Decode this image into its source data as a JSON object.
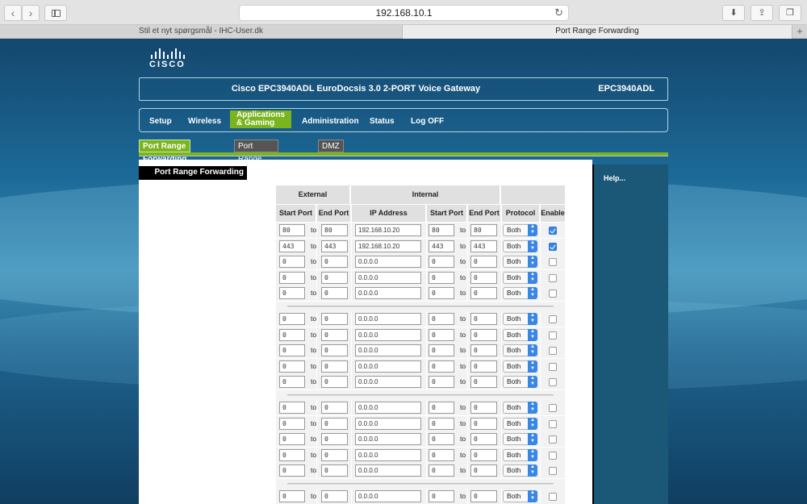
{
  "browser": {
    "url": "192.168.10.1",
    "tabs": [
      {
        "label": "Stil et nyt spørgsmål - IHC-User.dk",
        "active": false
      },
      {
        "label": "Port Range Forwarding",
        "active": true
      }
    ]
  },
  "brand": {
    "logo_text": "CISCO"
  },
  "header": {
    "product_title": "Cisco EPC3940ADL EuroDocsis 3.0 2-PORT Voice Gateway",
    "model": "EPC3940ADL"
  },
  "menu": {
    "items": [
      "Setup",
      "Wireless",
      "Applications & Gaming",
      "Administration",
      "Status",
      "Log OFF"
    ],
    "active_line1": "Applications",
    "active_line2": "& Gaming"
  },
  "subtabs": [
    "Port Range Forwarding",
    "Port Range Triggering",
    "DMZ"
  ],
  "sidebar": {
    "label": "Port Range Forwarding"
  },
  "help": {
    "label": "Help..."
  },
  "table": {
    "group_headers": {
      "external": "External",
      "internal": "Internal"
    },
    "columns": [
      "Start Port",
      "End Port",
      "IP Address",
      "Start Port",
      "End Port",
      "Protocol",
      "Enable"
    ],
    "to_label": "to",
    "rows": [
      {
        "ext_start": "80",
        "ext_end": "80",
        "ip": "192.168.10.20",
        "int_start": "80",
        "int_end": "80",
        "protocol": "Both",
        "enabled": true
      },
      {
        "ext_start": "443",
        "ext_end": "443",
        "ip": "192.168.10.20",
        "int_start": "443",
        "int_end": "443",
        "protocol": "Both",
        "enabled": true
      },
      {
        "ext_start": "0",
        "ext_end": "0",
        "ip": "0.0.0.0",
        "int_start": "0",
        "int_end": "0",
        "protocol": "Both",
        "enabled": false
      },
      {
        "ext_start": "0",
        "ext_end": "0",
        "ip": "0.0.0.0",
        "int_start": "0",
        "int_end": "0",
        "protocol": "Both",
        "enabled": false
      },
      {
        "ext_start": "0",
        "ext_end": "0",
        "ip": "0.0.0.0",
        "int_start": "0",
        "int_end": "0",
        "protocol": "Both",
        "enabled": false
      },
      {
        "ext_start": "0",
        "ext_end": "0",
        "ip": "0.0.0.0",
        "int_start": "0",
        "int_end": "0",
        "protocol": "Both",
        "enabled": false
      },
      {
        "ext_start": "0",
        "ext_end": "0",
        "ip": "0.0.0.0",
        "int_start": "0",
        "int_end": "0",
        "protocol": "Both",
        "enabled": false
      },
      {
        "ext_start": "0",
        "ext_end": "0",
        "ip": "0.0.0.0",
        "int_start": "0",
        "int_end": "0",
        "protocol": "Both",
        "enabled": false
      },
      {
        "ext_start": "0",
        "ext_end": "0",
        "ip": "0.0.0.0",
        "int_start": "0",
        "int_end": "0",
        "protocol": "Both",
        "enabled": false
      },
      {
        "ext_start": "0",
        "ext_end": "0",
        "ip": "0.0.0.0",
        "int_start": "0",
        "int_end": "0",
        "protocol": "Both",
        "enabled": false
      },
      {
        "ext_start": "0",
        "ext_end": "0",
        "ip": "0.0.0.0",
        "int_start": "0",
        "int_end": "0",
        "protocol": "Both",
        "enabled": false
      },
      {
        "ext_start": "0",
        "ext_end": "0",
        "ip": "0.0.0.0",
        "int_start": "0",
        "int_end": "0",
        "protocol": "Both",
        "enabled": false
      },
      {
        "ext_start": "0",
        "ext_end": "0",
        "ip": "0.0.0.0",
        "int_start": "0",
        "int_end": "0",
        "protocol": "Both",
        "enabled": false
      },
      {
        "ext_start": "0",
        "ext_end": "0",
        "ip": "0.0.0.0",
        "int_start": "0",
        "int_end": "0",
        "protocol": "Both",
        "enabled": false
      },
      {
        "ext_start": "0",
        "ext_end": "0",
        "ip": "0.0.0.0",
        "int_start": "0",
        "int_end": "0",
        "protocol": "Both",
        "enabled": false
      },
      {
        "ext_start": "0",
        "ext_end": "0",
        "ip": "0.0.0.0",
        "int_start": "0",
        "int_end": "0",
        "protocol": "Both",
        "enabled": false
      }
    ]
  },
  "colors": {
    "accent_green": "#7ab41e",
    "checkbox_blue": "#3a86e6",
    "help_panel": "#1b5776"
  }
}
